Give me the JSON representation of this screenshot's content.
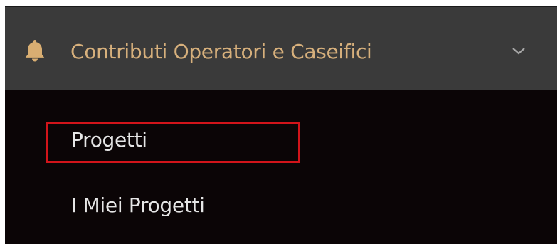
{
  "menu": {
    "header": {
      "label": "Contributi Operatori e Caseifici",
      "icon": "bell-icon",
      "expand_icon": "chevron-down-icon"
    },
    "items": [
      {
        "label": "Progetti",
        "highlighted": true
      },
      {
        "label": "I Miei Progetti",
        "highlighted": false
      }
    ]
  },
  "colors": {
    "header_background": "#3a3a3a",
    "panel_background": "#0b0506",
    "header_text": "#d7b07c",
    "item_text": "#e6e6e6",
    "highlight_border": "#d2141a"
  }
}
